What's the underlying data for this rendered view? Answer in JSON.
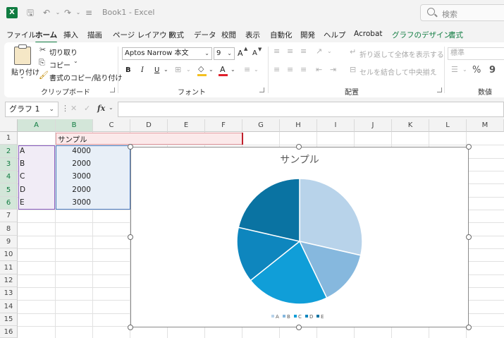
{
  "app": {
    "title": "Book1 - Excel",
    "logo_letter": "X",
    "search_placeholder": "検索",
    "title_buttons": [
      "save-icon",
      "undo-icon",
      "redo-icon",
      "customize-icon"
    ]
  },
  "tabs": [
    {
      "label": "ファイル",
      "state": "normal"
    },
    {
      "label": "ホーム",
      "state": "active"
    },
    {
      "label": "挿入",
      "state": "normal"
    },
    {
      "label": "描画",
      "state": "normal"
    },
    {
      "label": "ページ レイアウト",
      "state": "normal"
    },
    {
      "label": "数式",
      "state": "normal"
    },
    {
      "label": "データ",
      "state": "normal"
    },
    {
      "label": "校閲",
      "state": "normal"
    },
    {
      "label": "表示",
      "state": "normal"
    },
    {
      "label": "自動化",
      "state": "normal"
    },
    {
      "label": "開発",
      "state": "normal"
    },
    {
      "label": "ヘルプ",
      "state": "normal"
    },
    {
      "label": "Acrobat",
      "state": "normal"
    },
    {
      "label": "グラフのデザイン",
      "state": "contextual"
    },
    {
      "label": "書式",
      "state": "contextual"
    }
  ],
  "ribbon": {
    "clipboard": {
      "paste": "貼り付け",
      "cut": "切り取り",
      "copy": "コピー",
      "format_painter": "書式のコピー/貼り付け",
      "group_label": "クリップボード"
    },
    "font": {
      "font_name": "Aptos Narrow 本文",
      "font_size": "9",
      "grow": "A",
      "shrink": "A",
      "bold": "B",
      "italic": "I",
      "underline": "U",
      "font_color_letter": "A",
      "group_label": "フォント"
    },
    "alignment": {
      "wrap_text": "折り返して全体を表示する",
      "merge_center": "セルを結合して中央揃え",
      "group_label": "配置"
    },
    "number": {
      "format": "標準",
      "percent": "%",
      "comma": "9",
      "group_label": "数値"
    }
  },
  "formula_bar": {
    "name_box": "グラフ 1",
    "fx": "fx",
    "formula": ""
  },
  "sheet": {
    "columns": [
      "A",
      "B",
      "C",
      "D",
      "E",
      "F",
      "G",
      "H",
      "I",
      "J",
      "K",
      "L",
      "M"
    ],
    "rows": [
      "1",
      "2",
      "3",
      "4",
      "5",
      "6",
      "7",
      "8",
      "9",
      "10",
      "11",
      "12",
      "13",
      "14",
      "15",
      "16"
    ],
    "header_cell": "サンプル",
    "data_rows": [
      {
        "label": "A",
        "value": "4000"
      },
      {
        "label": "B",
        "value": "2000"
      },
      {
        "label": "C",
        "value": "3000"
      },
      {
        "label": "D",
        "value": "2000"
      },
      {
        "label": "E",
        "value": "3000"
      }
    ]
  },
  "chart_data": {
    "type": "pie",
    "title": "サンプル",
    "categories": [
      "A",
      "B",
      "C",
      "D",
      "E"
    ],
    "values": [
      4000,
      2000,
      3000,
      2000,
      3000
    ],
    "colors": [
      "#b8d3ea",
      "#86b8de",
      "#109ed8",
      "#0e86be",
      "#0a73a2"
    ],
    "legend": "bottom"
  }
}
